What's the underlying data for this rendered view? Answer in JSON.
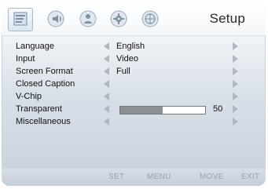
{
  "header": {
    "title": "Setup",
    "icons": [
      "setup-icon",
      "audio-icon",
      "person-icon",
      "gear-icon",
      "globe-icon"
    ]
  },
  "menu": [
    {
      "label": "Language",
      "value": "English"
    },
    {
      "label": "Input",
      "value": "Video"
    },
    {
      "label": "Screen Format",
      "value": "Full"
    },
    {
      "label": "Closed Caption",
      "value": ""
    },
    {
      "label": "V-Chip",
      "value": ""
    },
    {
      "label": "Transparent",
      "value": "50",
      "level_percent": 50
    },
    {
      "label": "Miscellaneous",
      "value": ""
    }
  ],
  "footer": {
    "set": "SET",
    "menu": "MENU",
    "move": "MOVE",
    "exit": "EXIT"
  },
  "colors": {
    "accent": "#8c8f93",
    "arrow": "#b0b7bf"
  }
}
